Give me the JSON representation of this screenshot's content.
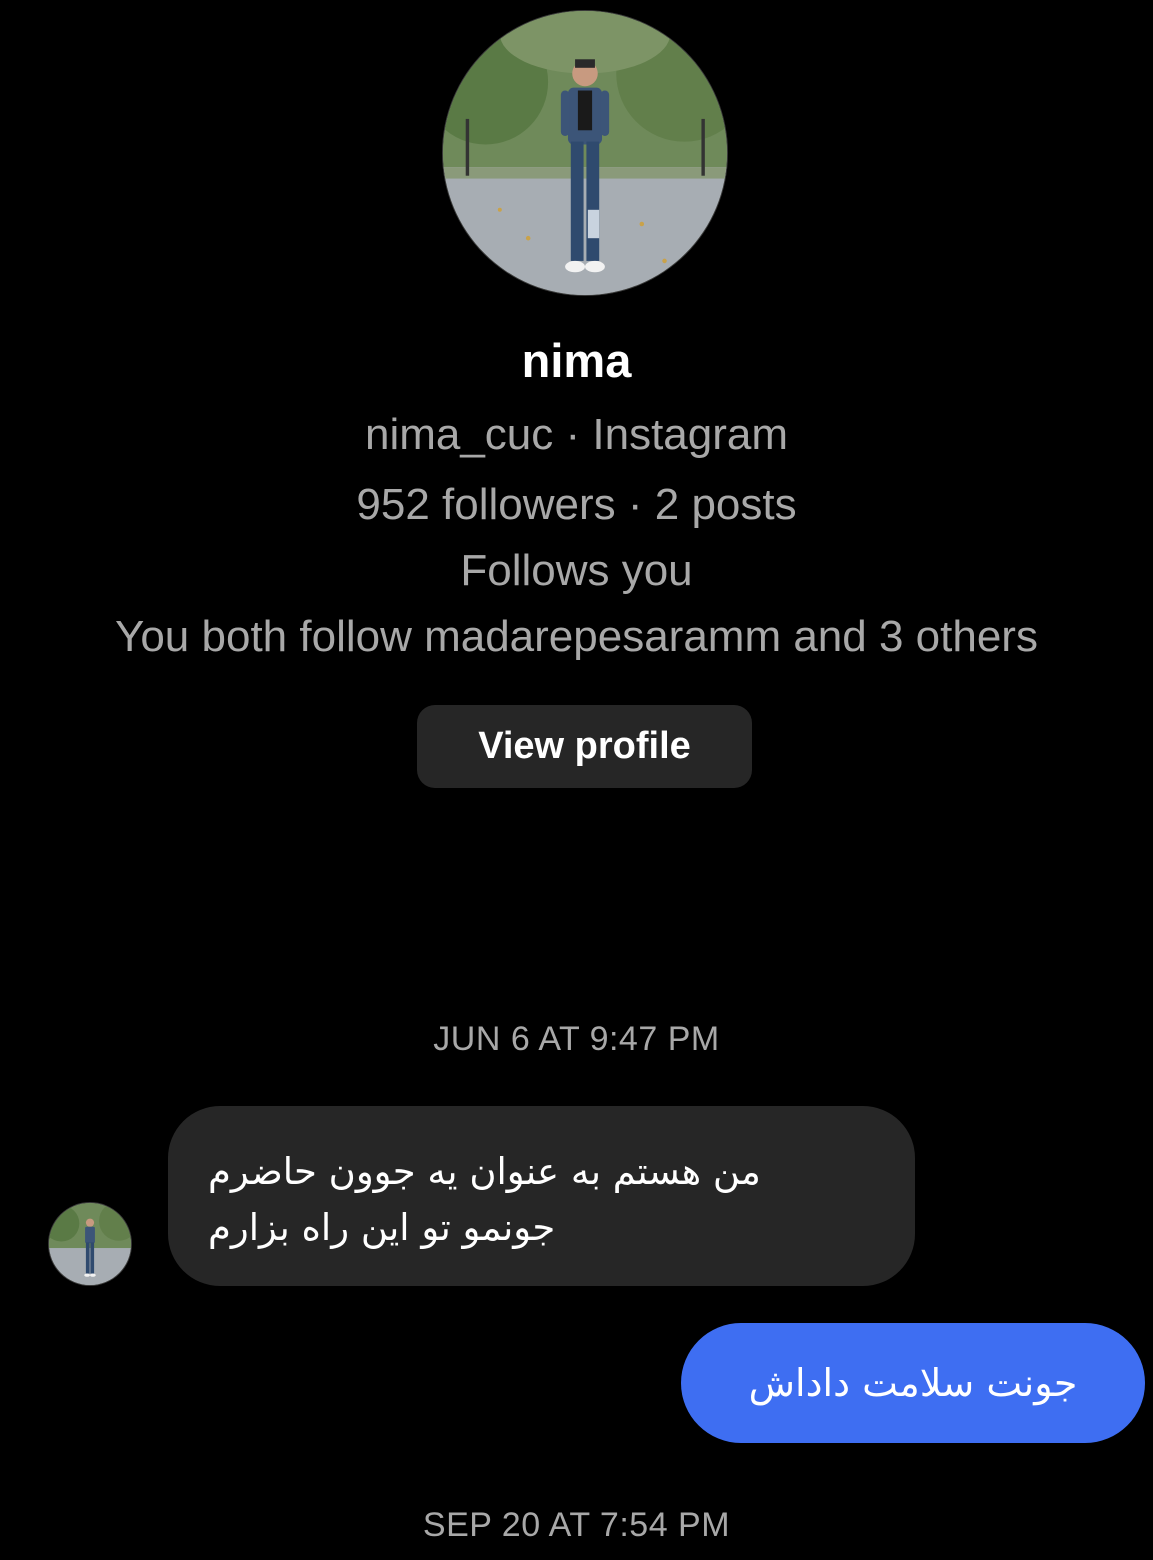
{
  "profile": {
    "name": "nima",
    "handle_line": "nima_cuc · Instagram",
    "stats_line": "952 followers · 2 posts",
    "follows_line": "Follows you",
    "mutual_line": "You both follow madarepesaramm and 3 others",
    "view_profile_label": "View profile"
  },
  "conversation": {
    "timestamp_1": "JUN 6 AT 9:47 PM",
    "incoming_message": {
      "line_1": "من هستم به عنوان یه جوون حاضرم",
      "line_2": "جونمو تو این راه بزارم"
    },
    "outgoing_message": "جونت سلامت داداش",
    "timestamp_2": "SEP 20 AT 7:54 PM"
  },
  "colors": {
    "background": "#000000",
    "incoming_bubble": "#262626",
    "outgoing_bubble": "#3e6ef2",
    "secondary_text": "#a8a8a8"
  }
}
